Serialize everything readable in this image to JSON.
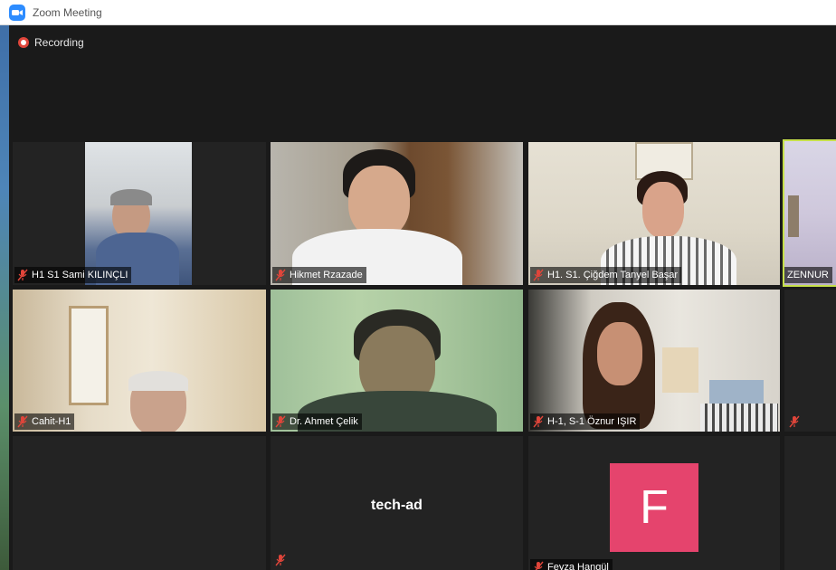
{
  "window": {
    "title": "Zoom Meeting"
  },
  "meeting": {
    "recording_label": "Recording"
  },
  "participants": [
    {
      "name": "H1 S1 Sami KILINÇLI",
      "muted": true
    },
    {
      "name": "Hikmet Rzazade",
      "muted": true
    },
    {
      "name": "H1. S1. Çiğdem Tanyel Başar",
      "muted": true
    },
    {
      "name": "ZENNUR",
      "muted": false,
      "active_speaker": true
    },
    {
      "name": "Cahit-H1",
      "muted": true
    },
    {
      "name": "Dr. Ahmet Çelik",
      "muted": true
    },
    {
      "name": "H-1, S-1 Öznur IŞIR",
      "muted": true
    },
    {
      "name": "",
      "muted": true
    },
    {
      "name": "",
      "muted": false
    },
    {
      "name": "tech-ad",
      "muted": true,
      "video_off": true
    },
    {
      "name": "Feyza Hangül",
      "muted": true,
      "video_off": true,
      "avatar_letter": "F"
    }
  ],
  "colors": {
    "zoom_blue": "#2d8cff",
    "active_outline": "#c6e04a",
    "avatar_pink": "#e5446d",
    "mute_red": "#e0453a"
  }
}
